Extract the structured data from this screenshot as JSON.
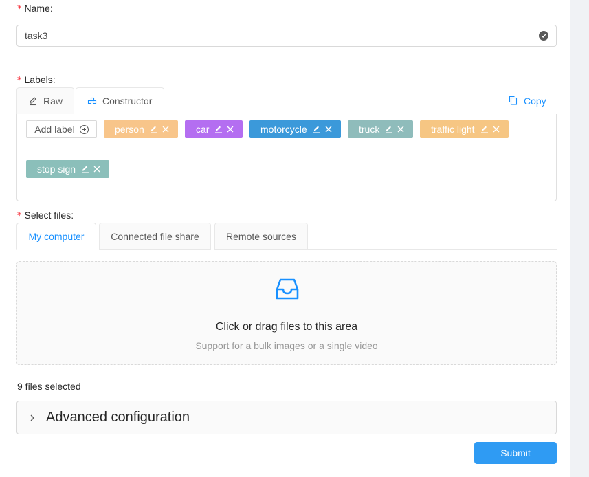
{
  "form": {
    "name_label": "Name",
    "name_colon": ":",
    "name_value": "task3",
    "labels_label": "Labels:",
    "files_label": "Select files:",
    "required_mark": "*"
  },
  "label_tabs": [
    {
      "label": "Raw",
      "icon": "edit-icon"
    },
    {
      "label": "Constructor",
      "icon": "build-icon"
    }
  ],
  "copy_label": "Copy",
  "add_label": "Add label",
  "labels": [
    {
      "name": "person",
      "color": "#f8c58a"
    },
    {
      "name": "car",
      "color": "#b46ef1"
    },
    {
      "name": "motorcycle",
      "color": "#3b99da"
    },
    {
      "name": "truck",
      "color": "#8fbcbb"
    },
    {
      "name": "traffic light",
      "color": "#f6c683"
    },
    {
      "name": "stop sign",
      "color": "#8bbfba"
    }
  ],
  "file_tabs": [
    {
      "label": "My computer",
      "active": true
    },
    {
      "label": "Connected file share",
      "active": false
    },
    {
      "label": "Remote sources",
      "active": false
    }
  ],
  "dropzone": {
    "title": "Click or drag files to this area",
    "hint": "Support for a bulk images or a single video",
    "icon": "inbox-icon"
  },
  "files_selected": "9 files selected",
  "advanced": {
    "title": "Advanced configuration",
    "icon": "chevron-right-icon"
  },
  "submit_label": "Submit",
  "colors": {
    "accent": "#1890ff",
    "submit": "#2f9bf3"
  }
}
